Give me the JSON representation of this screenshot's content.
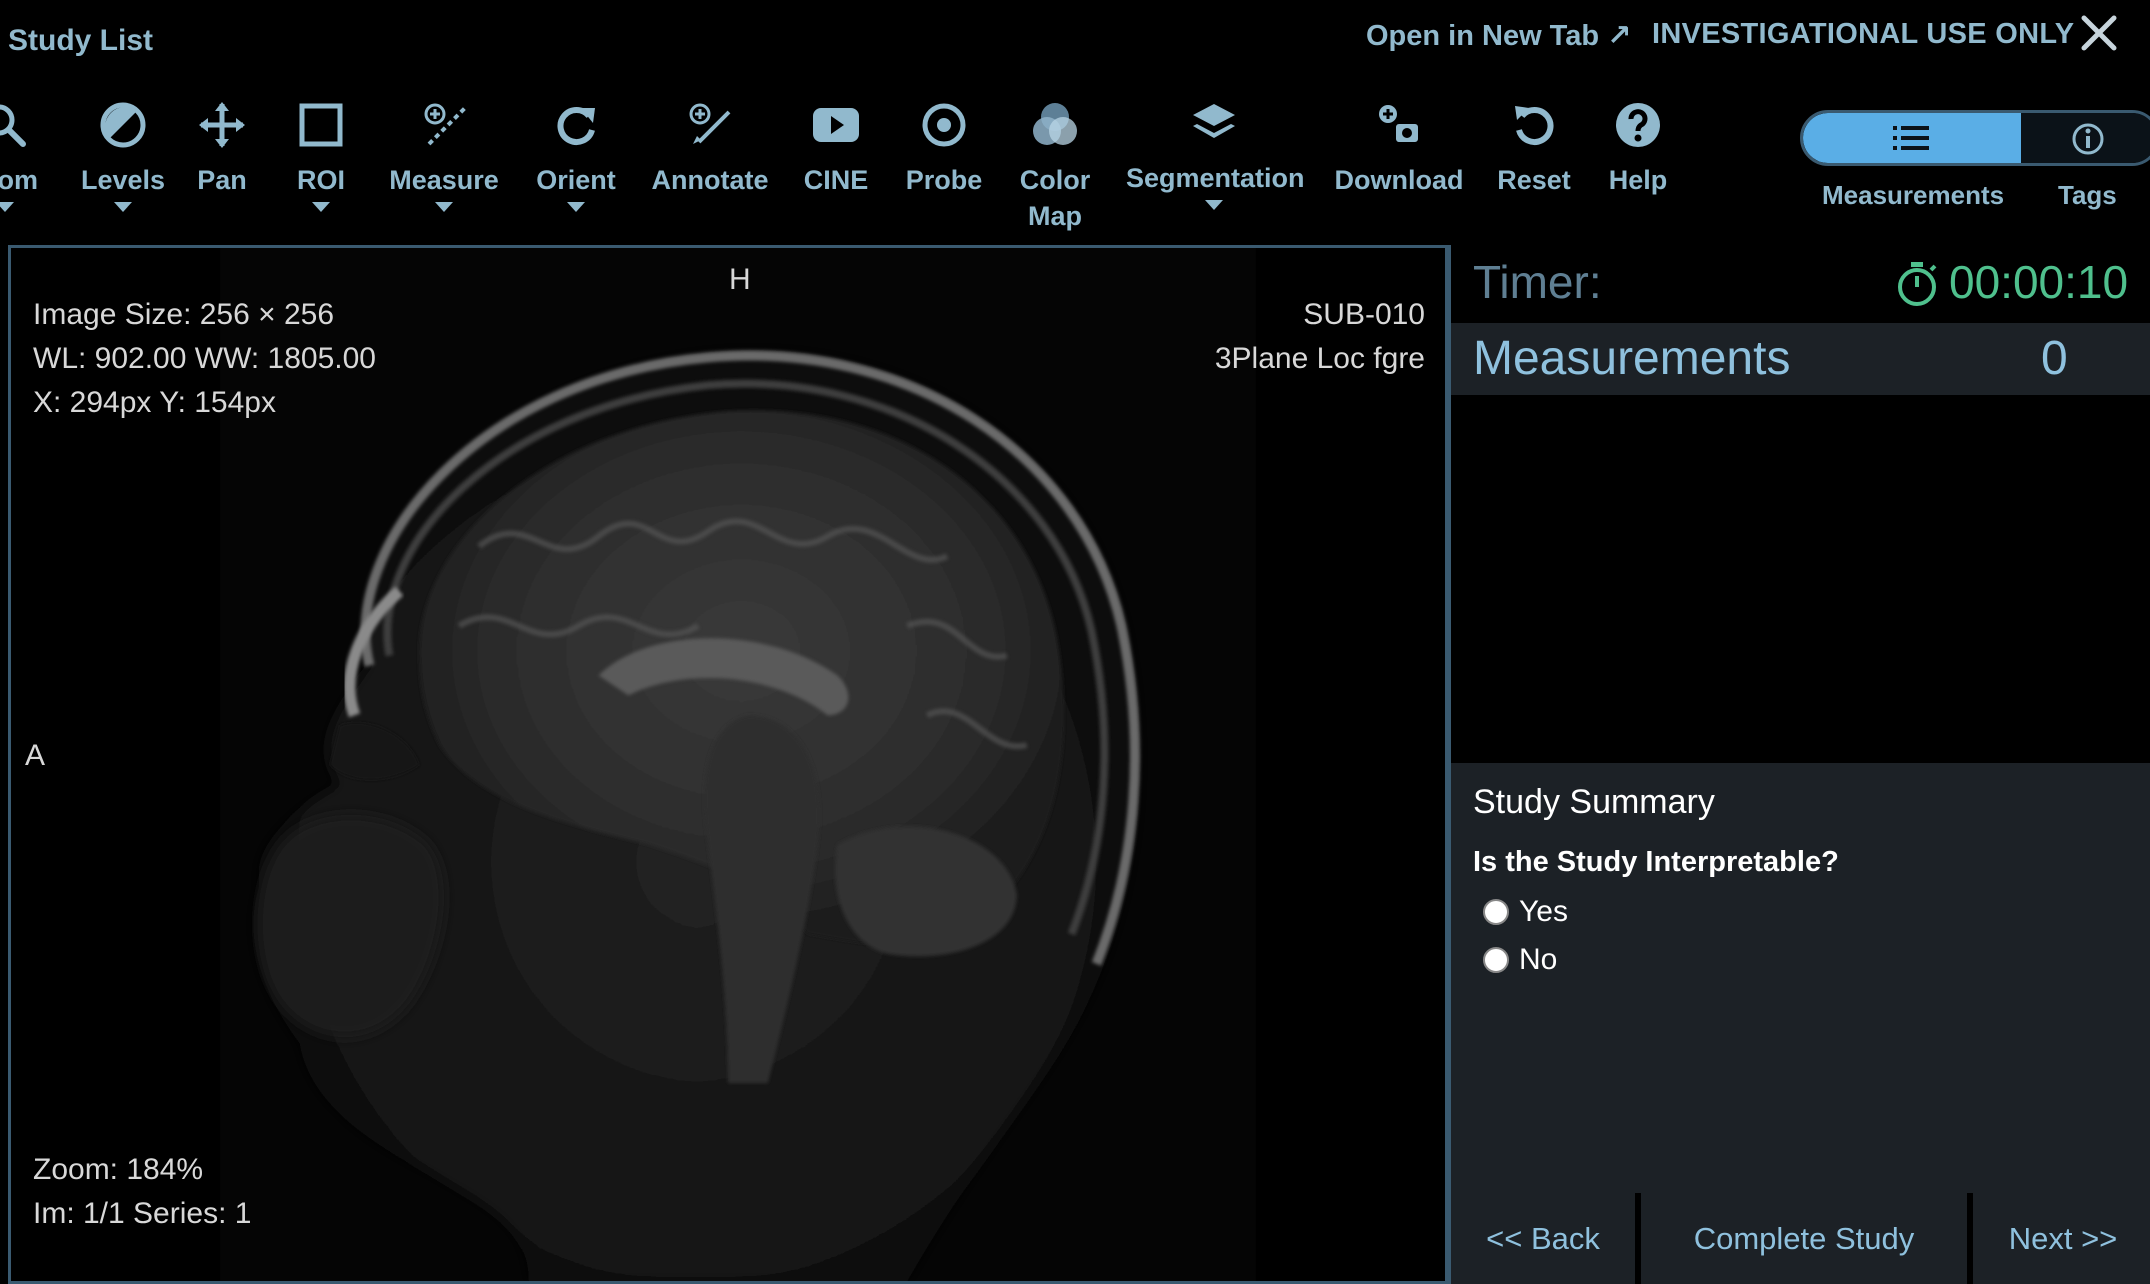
{
  "header": {
    "study_list": "Study List",
    "open_new_tab": "Open in New Tab ↗",
    "investigational": "INVESTIGATIONAL USE ONLY"
  },
  "toolbar": {
    "tools": [
      {
        "label": "om",
        "icon": "zoom-icon",
        "caret": true
      },
      {
        "label": "Levels",
        "icon": "levels-icon",
        "caret": true
      },
      {
        "label": "Pan",
        "icon": "pan-icon",
        "caret": false
      },
      {
        "label": "ROI",
        "icon": "roi-icon",
        "caret": true
      },
      {
        "label": "Measure",
        "icon": "measure-icon",
        "caret": true
      },
      {
        "label": "Orient",
        "icon": "orient-icon",
        "caret": true
      },
      {
        "label": "Annotate",
        "icon": "annotate-icon",
        "caret": false
      },
      {
        "label": "CINE",
        "icon": "cine-icon",
        "caret": false
      },
      {
        "label": "Probe",
        "icon": "probe-icon",
        "caret": false
      },
      {
        "label": "Color",
        "label2": "Map",
        "icon": "color-map-icon",
        "caret": false
      },
      {
        "label": "Segmentation",
        "icon": "segmentation-icon",
        "caret": true
      },
      {
        "label": "Download",
        "icon": "download-icon",
        "caret": false
      },
      {
        "label": "Reset",
        "icon": "reset-icon",
        "caret": false
      },
      {
        "label": "Help",
        "icon": "help-icon",
        "caret": false
      }
    ]
  },
  "panel_toggle": {
    "measurements_label": "Measurements",
    "tags_label": "Tags",
    "active": "Measurements"
  },
  "viewport": {
    "image_size": "Image Size: 256 × 256",
    "wl_ww": "WL: 902.00 WW: 1805.00",
    "coords": "X: 294px Y: 154px",
    "subject": "SUB-010",
    "series_desc": "3Plane Loc fgre",
    "zoom": "Zoom: 184%",
    "im_series": "Im: 1/1 Series: 1",
    "orient_top": "H",
    "orient_left": "A"
  },
  "panel": {
    "timer_label": "Timer:",
    "timer_value": "00:00:10",
    "measurements_label": "Measurements",
    "measurements_count": "0",
    "summary_title": "Study Summary",
    "summary_question": "Is the Study Interpretable?",
    "option_yes": "Yes",
    "option_no": "No",
    "back": "<< Back",
    "complete": "Complete Study",
    "next": "Next >>"
  },
  "colors": {
    "accent": "#5aaee6",
    "text_blue": "#91b9cd",
    "timer_green": "#4fc08d",
    "panel_bg": "#1c2126",
    "border": "#3a5a70"
  }
}
